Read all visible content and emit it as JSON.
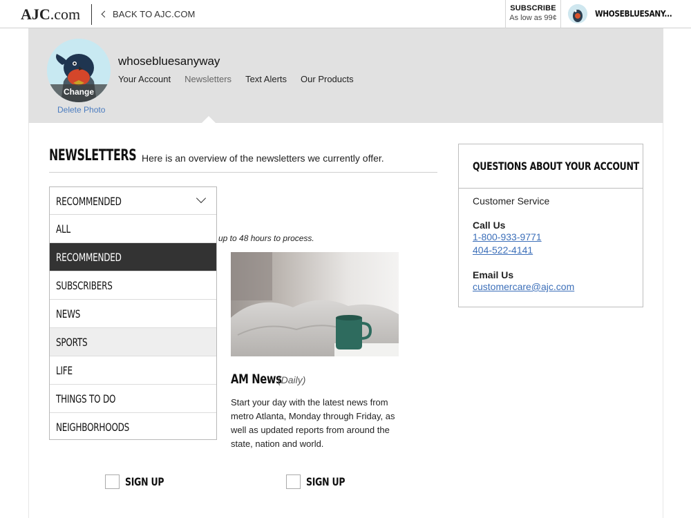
{
  "topbar": {
    "logo_bold": "AJC",
    "logo_rest": ".com",
    "back_label": "BACK TO AJC.COM",
    "subscribe_title": "SUBSCRIBE",
    "subscribe_price": "As low as 99¢",
    "user_name": "WHOSEBLUESANY..."
  },
  "profile": {
    "username": "whosebluesanyway",
    "change_label": "Change",
    "delete_label": "Delete Photo",
    "tabs": [
      {
        "label": "Your Account",
        "active": false
      },
      {
        "label": "Newsletters",
        "active": true
      },
      {
        "label": "Text Alerts",
        "active": false
      },
      {
        "label": "Our Products",
        "active": false
      }
    ]
  },
  "newsletters": {
    "title": "NEWSLETTERS",
    "description": "Here is an overview of the newsletters we currently offer.",
    "note": "up to 48 hours to process.",
    "filter": {
      "selected": "RECOMMENDED",
      "options": [
        "ALL",
        "RECOMMENDED",
        "SUBSCRIBERS",
        "NEWS",
        "SPORTS",
        "LIFE",
        "THINGS TO DO",
        "NEIGHBORHOODS"
      ],
      "highlighted": "SPORTS"
    },
    "card": {
      "title": "AM News",
      "frequency": "(Daily)",
      "description": "Start your day with the latest news from metro Atlanta, Monday through Friday, as well as updated reports from around the state, nation and world."
    },
    "signup_label": "SIGN UP"
  },
  "questions": {
    "title": "QUESTIONS ABOUT YOUR ACCOUNT",
    "service": "Customer Service",
    "call_label": "Call Us",
    "phone1": "1-800-933-9771",
    "phone2": "404-522-4141",
    "email_label": "Email Us",
    "email": "customercare@ajc.com"
  },
  "colors": {
    "link": "#3c6fb9",
    "header_bg": "#e1e1e1",
    "selected_bg": "#333333"
  }
}
